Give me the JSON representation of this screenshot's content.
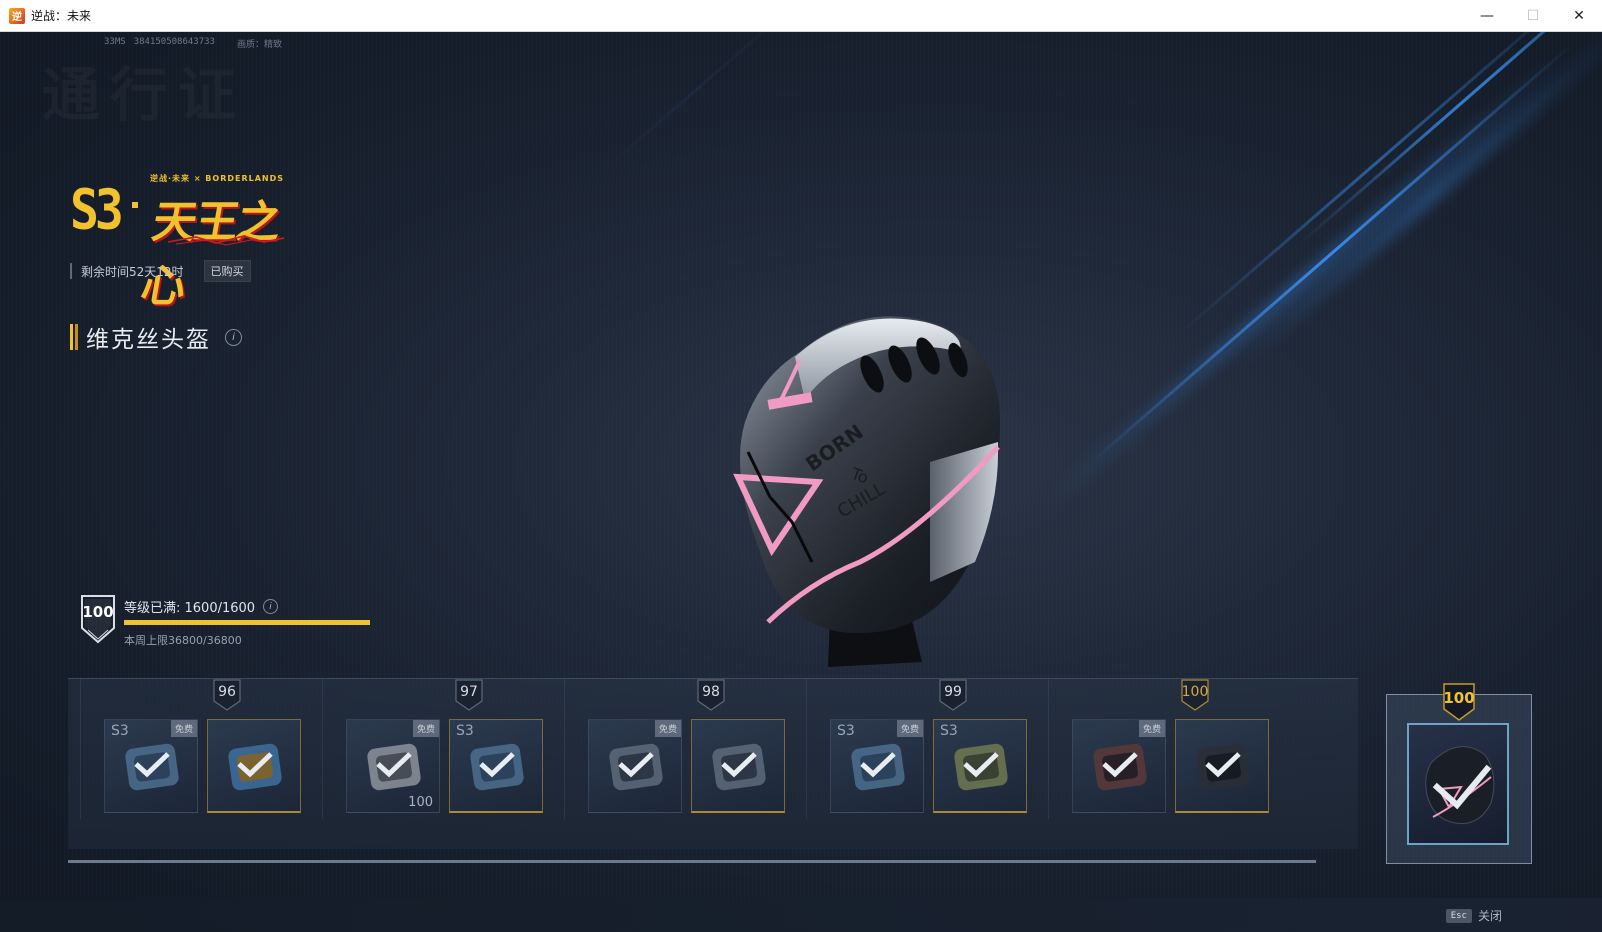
{
  "window": {
    "title": "逆战：未来",
    "minimize_label": "—",
    "maximize_label": "☐",
    "close_label": "✕"
  },
  "debug": {
    "ping": "33MS",
    "session_id": "384150508643733",
    "quality": "画质：精致"
  },
  "watermark": "通行证",
  "season": {
    "sub_label": "逆战·未来 × BORDERLANDS",
    "number": "S3",
    "name": "天王之心",
    "remaining_time": "剩余时间52天12时",
    "purchase_status": "已购买"
  },
  "item": {
    "title": "维克丝头盔",
    "info_icon": "i"
  },
  "level": {
    "badge": "100",
    "status": "等级已满: 1600/1600",
    "info_icon": "i",
    "progress_fraction": 1.0,
    "weekly_cap": "本周上限36800/36800"
  },
  "track": {
    "groups": [
      {
        "level": "96",
        "gold": false,
        "rewards": [
          {
            "tag": "S3",
            "free": "免费",
            "count": "",
            "claimed": true,
            "icon": "armor-crate-icon"
          },
          {
            "tag": "",
            "free": "",
            "count": "",
            "claimed": true,
            "icon": "phone-device-icon"
          }
        ]
      },
      {
        "level": "97",
        "gold": false,
        "rewards": [
          {
            "tag": "",
            "free": "免费",
            "count": "100",
            "claimed": true,
            "icon": "voucher-card-icon"
          },
          {
            "tag": "S3",
            "free": "",
            "count": "",
            "claimed": true,
            "icon": "armor-crate-icon"
          }
        ]
      },
      {
        "level": "98",
        "gold": false,
        "rewards": [
          {
            "tag": "",
            "free": "免费",
            "count": "",
            "claimed": true,
            "icon": "supply-box-icon"
          },
          {
            "tag": "",
            "free": "",
            "count": "",
            "claimed": true,
            "icon": "supply-box-icon"
          }
        ]
      },
      {
        "level": "99",
        "gold": false,
        "rewards": [
          {
            "tag": "S3",
            "free": "免费",
            "count": "",
            "claimed": true,
            "icon": "armor-crate-icon"
          },
          {
            "tag": "S3",
            "free": "",
            "count": "",
            "claimed": true,
            "icon": "armor-crate-gold-icon"
          }
        ]
      },
      {
        "level": "100",
        "gold": true,
        "rewards": [
          {
            "tag": "",
            "free": "免费",
            "count": "",
            "claimed": true,
            "icon": "weapon-parts-icon"
          },
          {
            "tag": "",
            "free": "",
            "count": "",
            "claimed": true,
            "icon": "helmet-icon"
          }
        ]
      }
    ],
    "final_reward": {
      "level": "100",
      "claimed": true,
      "icon": "helmet-icon"
    }
  },
  "footer": {
    "esc_key": "Esc",
    "close_label": "关闭"
  },
  "colors": {
    "accent_gold": "#f2c12e",
    "helmet_pink": "#f19bc4",
    "streak_blue": "#3c96ff"
  }
}
